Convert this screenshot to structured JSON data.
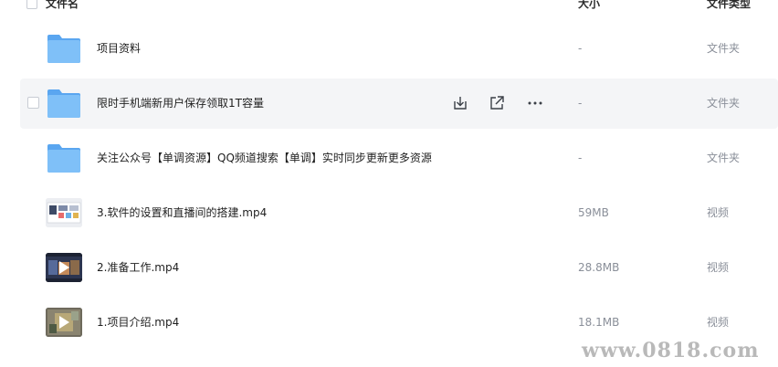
{
  "header": {
    "name_label": "文件名",
    "size_label": "大小",
    "type_label": "文件类型"
  },
  "files": [
    {
      "name": "项目资料",
      "size": "-",
      "type": "文件夹",
      "kind": "folder-icon"
    },
    {
      "name": "限时手机端新用户保存领取1T容量",
      "size": "-",
      "type": "文件夹",
      "kind": "folder-icon"
    },
    {
      "name": "关注公众号【单调资源】QQ频道搜索【单调】实时同步更新更多资源",
      "size": "-",
      "type": "文件夹",
      "kind": "folder-icon"
    },
    {
      "name": "3.软件的设置和直播间的搭建.mp4",
      "size": "59MB",
      "type": "视频",
      "kind": "video-thumbnail"
    },
    {
      "name": "2.准备工作.mp4",
      "size": "28.8MB",
      "type": "视频",
      "kind": "video-thumbnail"
    },
    {
      "name": "1.项目介绍.mp4",
      "size": "18.1MB",
      "type": "视频",
      "kind": "video-thumbnail"
    }
  ],
  "row_actions": {
    "icons": [
      "download-icon",
      "share-icon",
      "more-icon"
    ]
  },
  "watermark": "www.0818.com",
  "colors": {
    "folder": "#6fb4f5",
    "hover_row": "#f4f5f7",
    "muted_text": "#8a8f99"
  }
}
